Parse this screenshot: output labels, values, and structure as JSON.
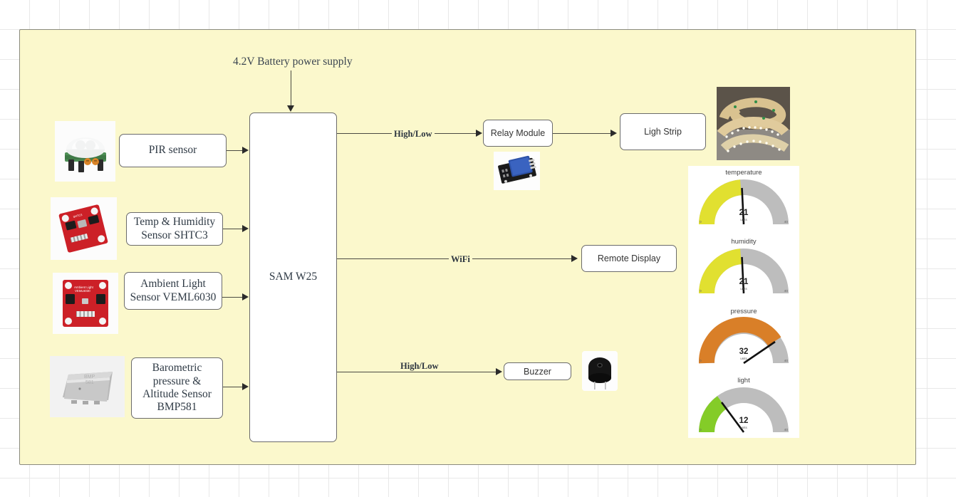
{
  "diagram": {
    "title": "4.2V Battery power supply",
    "controller": {
      "label": "SAM W25"
    },
    "sensors": [
      {
        "label": "PIR sensor",
        "image": "pir-sensor-photo"
      },
      {
        "label": "Temp & Humidity Sensor SHTC3",
        "image": "shtc3-sensor-photo"
      },
      {
        "label": "Ambient Light Sensor VEML6030",
        "image": "veml6030-sensor-photo"
      },
      {
        "label": "Barometric pressure & Altitude Sensor BMP581",
        "image": "bmp581-sensor-photo"
      }
    ],
    "outputs": [
      {
        "label": "Relay Module",
        "image": "relay-module-photo"
      },
      {
        "label": "Ligh Strip",
        "image": "led-light-strip-photo"
      },
      {
        "label": "Remote Display"
      },
      {
        "label": "Buzzer",
        "image": "buzzer-photo"
      }
    ],
    "edge_labels": {
      "relay": "High/Low",
      "display": "WiFi",
      "buzzer": "High/Low"
    },
    "colors": {
      "canvas": "#fbf8cc",
      "node_border": "#6b6b6b",
      "connector": "#4a4a42",
      "gauge_track": "#bdbdbd",
      "gauge_yellow": "#e1e030",
      "gauge_orange": "#d97f28",
      "gauge_green": "#84cc28"
    }
  },
  "gauges": [
    {
      "title": "temperature",
      "value": "21",
      "units": "units",
      "min": "0",
      "max": "40",
      "fraction": 0.52,
      "color": "#e1e030"
    },
    {
      "title": "humidity",
      "value": "21",
      "units": "units",
      "min": "0",
      "max": "40",
      "fraction": 0.52,
      "color": "#e1e030"
    },
    {
      "title": "pressure",
      "value": "32",
      "units": "units",
      "min": "0",
      "max": "40",
      "fraction": 0.8,
      "color": "#d97f28"
    },
    {
      "title": "light",
      "value": "12",
      "units": "units",
      "min": "0",
      "max": "40",
      "fraction": 0.3,
      "color": "#84cc28"
    }
  ]
}
